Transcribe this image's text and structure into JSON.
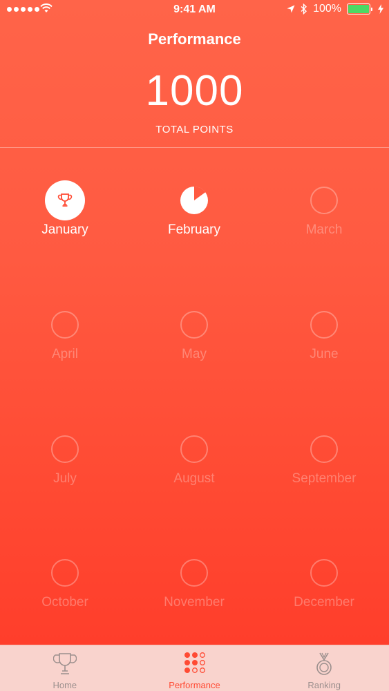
{
  "status_bar": {
    "time": "9:41 AM",
    "battery_percent": "100%",
    "battery_level": 1.0,
    "icons": [
      "signal-dots",
      "wifi-icon",
      "location-icon",
      "bluetooth-icon",
      "battery-icon",
      "charging-icon"
    ]
  },
  "header": {
    "title": "Performance",
    "total_points": "1000",
    "total_points_label": "TOTAL POINTS"
  },
  "months": [
    {
      "label": "January",
      "state": "trophy"
    },
    {
      "label": "February",
      "state": "partial",
      "progress": 0.85
    },
    {
      "label": "March",
      "state": "empty"
    },
    {
      "label": "April",
      "state": "empty"
    },
    {
      "label": "May",
      "state": "empty"
    },
    {
      "label": "June",
      "state": "empty"
    },
    {
      "label": "July",
      "state": "empty"
    },
    {
      "label": "August",
      "state": "empty"
    },
    {
      "label": "September",
      "state": "empty"
    },
    {
      "label": "October",
      "state": "empty"
    },
    {
      "label": "November",
      "state": "empty"
    },
    {
      "label": "December",
      "state": "empty"
    }
  ],
  "tab_bar": {
    "tabs": [
      {
        "label": "Home",
        "icon": "trophy-icon",
        "selected": false
      },
      {
        "label": "Performance",
        "icon": "grid-dots-icon",
        "selected": true
      },
      {
        "label": "Ranking",
        "icon": "medal-icon",
        "selected": false
      }
    ]
  },
  "colors": {
    "accent": "#ff4a33",
    "background_top": "#ff6449",
    "background_bottom": "#ff3e2b",
    "tab_bar_bg": "#f9d3cd",
    "tab_inactive": "#9b8f8d",
    "battery_green": "#4cd964"
  }
}
